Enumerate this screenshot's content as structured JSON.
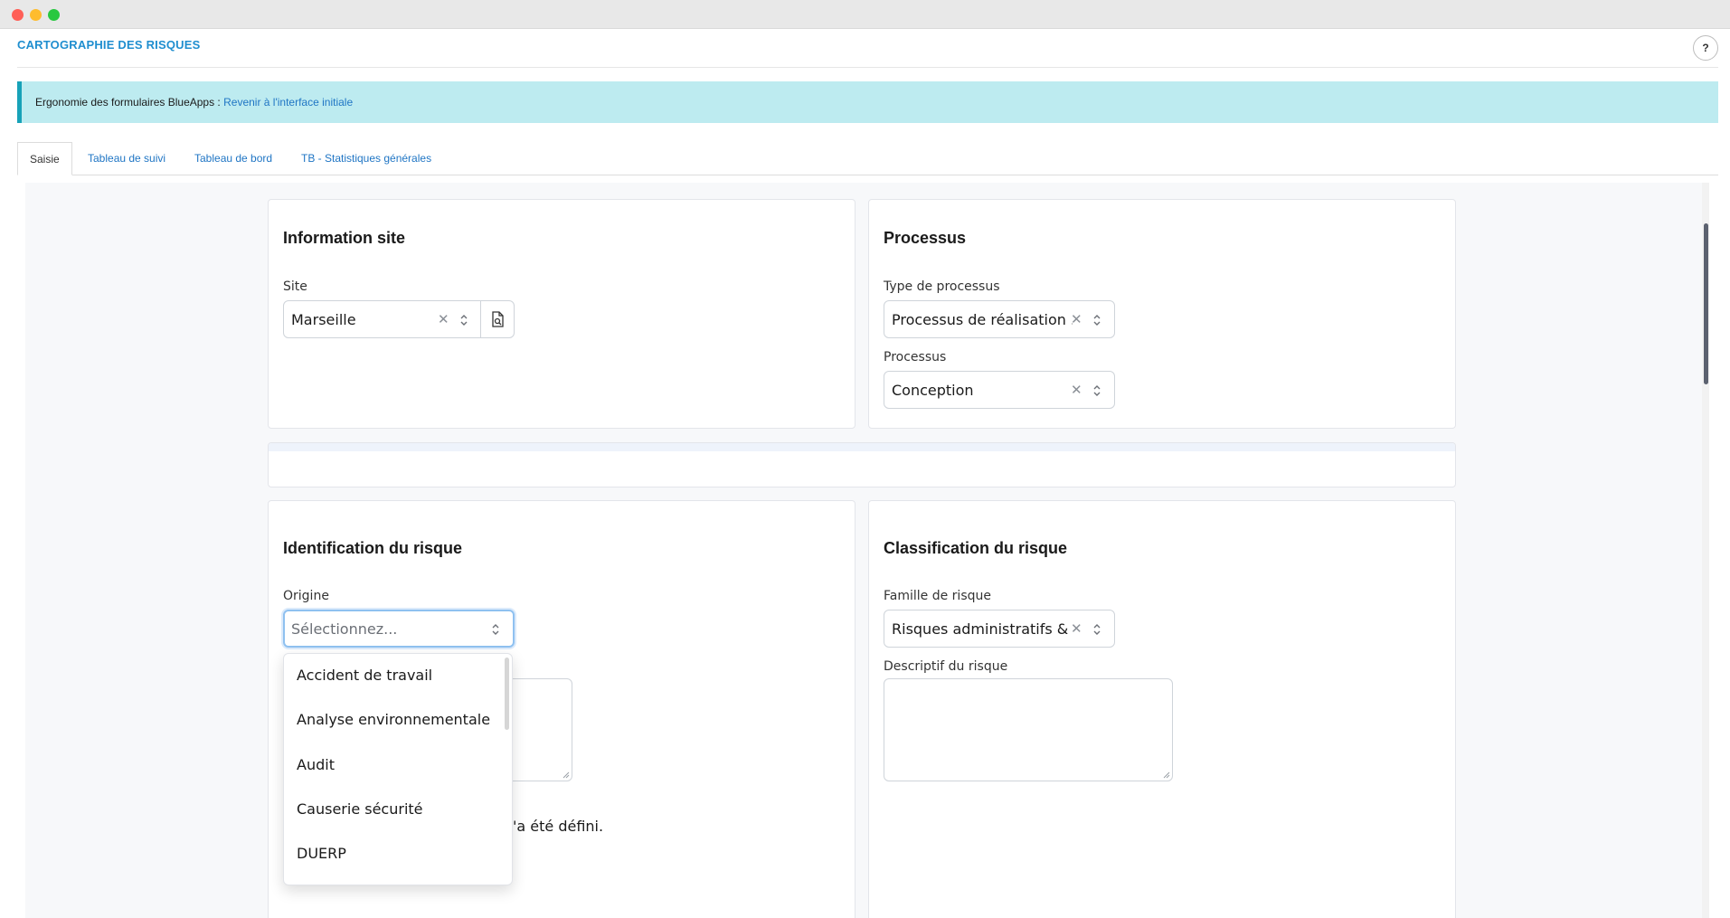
{
  "app": {
    "title": "CARTOGRAPHIE DES RISQUES",
    "help_label": "?"
  },
  "banner": {
    "text": "Ergonomie des formulaires BlueApps : ",
    "link": "Revenir à l'interface initiale"
  },
  "tabs": [
    {
      "label": "Saisie",
      "active": true
    },
    {
      "label": "Tableau de suivi"
    },
    {
      "label": "Tableau de bord"
    },
    {
      "label": "TB - Statistiques générales"
    }
  ],
  "info_site": {
    "title": "Information site",
    "site_label": "Site",
    "site_value": "Marseille"
  },
  "processus": {
    "title": "Processus",
    "type_label": "Type de processus",
    "type_value": "Processus de réalisation ...",
    "processus_label": "Processus",
    "processus_value": "Conception"
  },
  "identification": {
    "title": "Identification du risque",
    "origine_label": "Origine",
    "origine_placeholder": "Sélectionnez...",
    "partial_text": "'a été défini."
  },
  "dropdown": {
    "options": [
      "Accident de travail",
      "Analyse environnementale",
      "Audit",
      "Causerie sécurité",
      "DUERP"
    ]
  },
  "classification": {
    "title": "Classification du risque",
    "famille_label": "Famille de risque",
    "famille_value": "Risques administratifs & ...",
    "descriptif_label": "Descriptif du risque"
  },
  "icons": {
    "clear": "close-icon",
    "updown": "chevron-updown-icon",
    "lookup": "document-search-icon"
  }
}
